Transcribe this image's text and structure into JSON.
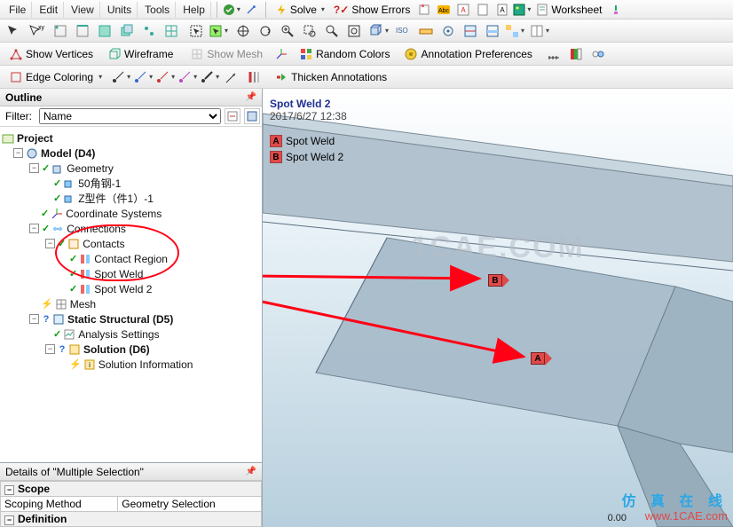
{
  "menus": {
    "file": "File",
    "edit": "Edit",
    "view": "View",
    "units": "Units",
    "tools": "Tools",
    "help": "Help"
  },
  "top_btns": {
    "solve": "Solve",
    "show_errors": "Show Errors",
    "worksheet": "Worksheet"
  },
  "toolbar2": {
    "show_vertices": "Show Vertices",
    "wireframe": "Wireframe",
    "show_mesh": "Show Mesh",
    "random_colors": "Random Colors",
    "annotation_prefs": "Annotation Preferences"
  },
  "toolbar3": {
    "edge_coloring": "Edge Coloring",
    "thicken": "Thicken Annotations"
  },
  "outline": {
    "title": "Outline",
    "filter_label": "Filter:",
    "filter_value": "Name",
    "tree": {
      "project": "Project",
      "model": "Model (D4)",
      "geometry": "Geometry",
      "geo1": "50角钢-1",
      "geo2": "Z型件（件1）-1",
      "coord": "Coordinate Systems",
      "connections": "Connections",
      "contacts": "Contacts",
      "contact_region": "Contact Region",
      "spot1": "Spot Weld",
      "spot2": "Spot Weld 2",
      "mesh": "Mesh",
      "static": "Static Structural (D5)",
      "analysis": "Analysis Settings",
      "solution": "Solution (D6)",
      "solinfo": "Solution Information"
    }
  },
  "details": {
    "title": "Details of \"Multiple Selection\"",
    "scope": "Scope",
    "scoping_method": "Scoping Method",
    "scoping_value": "Geometry Selection",
    "definition": "Definition"
  },
  "viewport": {
    "title": "Spot Weld 2",
    "timestamp": "2017/6/27 12:38",
    "legend": {
      "a": "A",
      "a_label": "Spot Weld",
      "b": "B",
      "b_label": "Spot Weld 2"
    },
    "marker_a": "A",
    "marker_b": "B",
    "scale_zero": "0.00",
    "watermark": "1CAE.COM",
    "wm1": "仿 真 在 线",
    "wm2": "www.1CAE.com"
  },
  "icons": {
    "check": "●",
    "bolt": "⚡",
    "ab": "📄",
    "q": "?",
    "gear": "⚙",
    "play": "▶"
  }
}
